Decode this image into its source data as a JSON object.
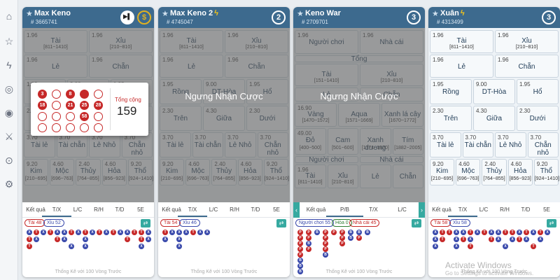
{
  "sidebar_icons": [
    "home-icon",
    "star-icon",
    "bolt-icon",
    "coin-icon",
    "target-icon",
    "sword-icon",
    "lock-icon",
    "settings-icon"
  ],
  "common": {
    "tabs_std": [
      "Kết quả",
      "T/X",
      "L/C",
      "R/H",
      "T/D",
      "5E"
    ],
    "footer": "Thống Kê với 100 Vòng Trước"
  },
  "panels": [
    {
      "title": "Max Keno",
      "bolt": false,
      "id": "# 3665741",
      "btn_icon": "▶▌",
      "coin_icon": "$",
      "popup": {
        "total_label": "Tổng cộng",
        "total_value": "159",
        "balls": [
          "3",
          "",
          "8",
          "",
          "",
          "18",
          "",
          "21",
          "25",
          "28",
          "",
          "",
          "",
          "58",
          "",
          "",
          "",
          "",
          "",
          ""
        ]
      },
      "badges": [
        {
          "text": "Tài 48",
          "kind": "red"
        },
        {
          "text": "Xỉu 52",
          "kind": "blue"
        }
      ]
    },
    {
      "title": "Max Keno 2",
      "bolt": true,
      "id": "# 4745047",
      "timer": "2",
      "notice": "Ngưng Nhận Cược",
      "badges": [
        {
          "text": "Tài 54",
          "kind": "red"
        },
        {
          "text": "Xỉu 46",
          "kind": "blue"
        }
      ]
    },
    {
      "title": "Keno War",
      "bolt": false,
      "id": "# 2709701",
      "timer": "3",
      "notice": "Ngưng Nhận Cược",
      "tabs": [
        "Kết quả",
        "P/B",
        "T/X",
        "L/C"
      ],
      "badges": [
        {
          "text": "Người chơi 55",
          "kind": "blue"
        },
        {
          "text": "Hòa 0",
          "kind": "green"
        },
        {
          "text": "Nhà cái 45",
          "kind": "red"
        }
      ]
    },
    {
      "title": "Xuân",
      "bolt": true,
      "id": "# 4313499",
      "timer": "3",
      "badges": [
        {
          "text": "Tài 58",
          "kind": "red"
        },
        {
          "text": "Xỉu 58",
          "kind": "blue"
        }
      ]
    }
  ],
  "keno_cells": [
    {
      "odds": "1.96",
      "name": "Tài",
      "range": "[811~1410]"
    },
    {
      "odds": "1.96",
      "name": "Xỉu",
      "range": "[210~810]"
    },
    {
      "odds": "1.96",
      "name": "Lẻ",
      "range": ""
    },
    {
      "odds": "1.96",
      "name": "Chẵn",
      "range": ""
    },
    {
      "odds": "1.95",
      "name": "Rồng",
      "range": ""
    },
    {
      "odds": "9.00",
      "name": "DT-Hòa",
      "range": ""
    },
    {
      "odds": "1.95",
      "name": "Hổ",
      "range": ""
    },
    {
      "odds": "2.30",
      "name": "Trên",
      "range": ""
    },
    {
      "odds": "4.30",
      "name": "Giữa",
      "range": ""
    },
    {
      "odds": "2.30",
      "name": "Dưới",
      "range": ""
    },
    {
      "odds": "3.70",
      "name": "Tài lẻ",
      "range": ""
    },
    {
      "odds": "3.70",
      "name": "Tài chẵn",
      "range": ""
    },
    {
      "odds": "3.70",
      "name": "Lẻ Nhỏ",
      "range": ""
    },
    {
      "odds": "3.70",
      "name": "Chẵn nhỏ",
      "range": ""
    },
    {
      "odds": "9.20",
      "name": "Kim",
      "range": "[210~695]"
    },
    {
      "odds": "4.60",
      "name": "Mộc",
      "range": "[696~763]"
    },
    {
      "odds": "2.40",
      "name": "Thủy",
      "range": "[764~855]"
    },
    {
      "odds": "4.60",
      "name": "Hỏa",
      "range": "[856~923]"
    },
    {
      "odds": "9.20",
      "name": "Thổ",
      "range": "[924~1410]"
    }
  ],
  "war_cells": [
    {
      "odds": "1.96",
      "name": "Người chơi",
      "range": ""
    },
    {
      "odds": "1.96",
      "name": "Nhà cái",
      "range": ""
    },
    {
      "odds": "",
      "name": "Tổng",
      "range": ""
    },
    {
      "odds": "",
      "name": "Tài",
      "range": "[151~1410]"
    },
    {
      "odds": "",
      "name": "Xỉu",
      "range": "[210~810]"
    },
    {
      "odds": "",
      "name": "Lẻ",
      "range": ""
    },
    {
      "odds": "",
      "name": "Chẵn",
      "range": ""
    },
    {
      "odds": "16.90",
      "name": "Vàng",
      "range": "[1470~1572]"
    },
    {
      "odds": "",
      "name": "Aqua",
      "range": "[1571~1669]"
    },
    {
      "odds": "",
      "name": "Xanh lá cây",
      "range": "[1670~1772]"
    },
    {
      "odds": "49.00",
      "name": "Đỏ",
      "range": "[400~500]"
    },
    {
      "odds": "",
      "name": "Cam",
      "range": "[501~600]"
    },
    {
      "odds": "",
      "name": "Xanh dương",
      "range": "[1771~1870]"
    },
    {
      "odds": "",
      "name": "Tím",
      "range": "[1882~2005]"
    },
    {
      "odds": "",
      "name": "Người chơi",
      "range": ""
    },
    {
      "odds": "",
      "name": "Nhà cái",
      "range": ""
    },
    {
      "odds": "1.96",
      "name": "Tài",
      "range": "[811~1410]"
    },
    {
      "odds": "",
      "name": "Xỉu",
      "range": "[210~810]"
    },
    {
      "odds": "",
      "name": "Lẻ",
      "range": ""
    },
    {
      "odds": "",
      "name": "Chẵn",
      "range": ""
    }
  ],
  "history": {
    "p1_top": "XTXTXXTXTXTXTXXTTX",
    "p1_mid": "TX..TX..X.....T.TX",
    "p1_bot": "T.....X.X.......X.",
    "p4_top": "XTTXXTXTXXTTXTXTX",
    "p4_mid": "XT.XTX..TX.XTX.X.",
    "p4_bot": "X..X.T....X...T.."
  },
  "colors": {
    "header": "#3d6a8e",
    "tai": "#c62828",
    "xiu": "#3949ab",
    "accent": "#36a9a0"
  },
  "watermark": {
    "line1": "Activate Windows",
    "line2": "Go to Settings to activate Windows."
  }
}
